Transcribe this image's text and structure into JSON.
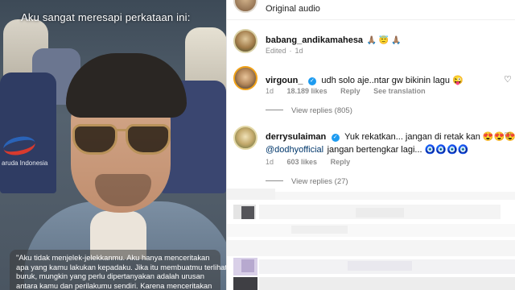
{
  "video": {
    "caption_top": "Aku sangat meresapi perkataan ini:",
    "seat_text": "aruda Indonesia",
    "caption_lines": [
      "\"Aku tidak menjelek-jelekkanmu. Aku hanya menceritakan",
      "apa yang kamu lakukan kepadaku. Jika itu membuatmu terlihat",
      "buruk, mungkin yang perlu dipertanyakan adalah urusan",
      "antara  kamu dan perilakumu sendiri. Karena menceritakan"
    ]
  },
  "header": {
    "audio_label": "Original audio"
  },
  "comments": [
    {
      "username": "babang_andikamahesa",
      "text": "🙏🏽 😇 🙏🏽",
      "meta": {
        "edited": "Edited",
        "time": "1d"
      }
    },
    {
      "username": "virgoun_",
      "verified_icon": "✓",
      "text": "udh solo aje..ntar gw bikinin lagu 😜",
      "meta": {
        "time": "1d",
        "likes": "18.189 likes",
        "reply": "Reply",
        "translation": "See translation"
      },
      "view_replies": "View replies (805)"
    },
    {
      "username": "derrysulaiman",
      "verified_icon": "✓",
      "text": "Yuk rekatkan... jangan di retak kan 😍😍😍",
      "mention": "@dodhyofficial",
      "text2": "jangan bertengkar lagi... 🧿🧿🧿🧿",
      "meta": {
        "time": "1d",
        "likes": "603 likes",
        "reply": "Reply"
      },
      "view_replies": "View replies (27)"
    }
  ],
  "colors": {
    "accent_link": "#00376b",
    "verified": "#1d9bf0",
    "muted": "#8e8e8e"
  }
}
